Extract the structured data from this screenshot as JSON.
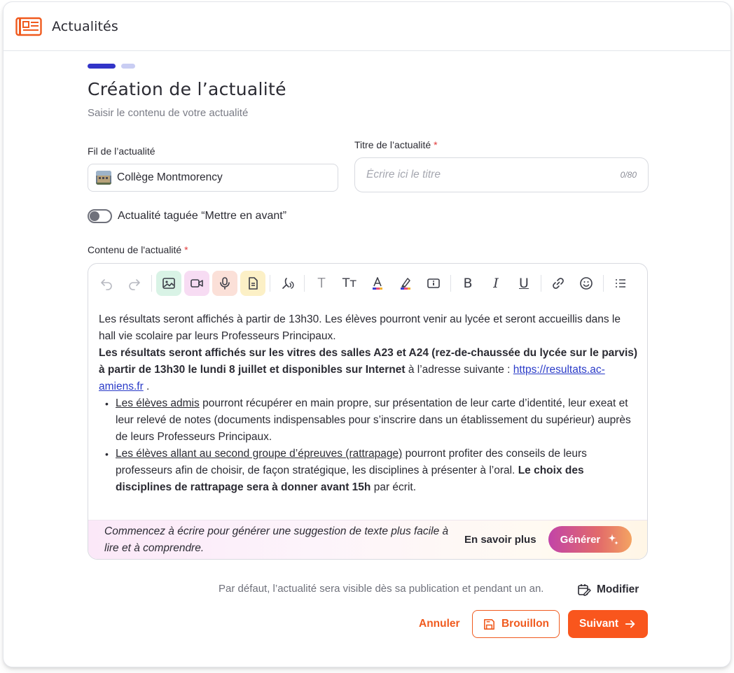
{
  "header": {
    "title": "Actualités",
    "icon": "newspaper-icon"
  },
  "steps": {
    "current": 1,
    "total": 2
  },
  "page": {
    "title": "Création de l’actualité",
    "subtitle": "Saisir le contenu de votre actualité"
  },
  "form": {
    "feed_label": "Fil de l’actualité",
    "feed_value": "Collège Montmorency",
    "title_label": "Titre de l’actualité",
    "required_mark": "*",
    "title_placeholder": "Écrire ici le titre",
    "title_counter": "0/80",
    "toggle_label": "Actualité taguée “Mettre en avant”",
    "toggle_on": false,
    "content_label": "Contenu de l'actualité"
  },
  "toolbar": {
    "tools": [
      "undo-icon",
      "redo-icon",
      "image-icon",
      "video-icon",
      "microphone-icon",
      "document-icon",
      "voice-icon",
      "text-icon",
      "text-size-icon",
      "text-color-icon",
      "highlight-icon",
      "info-box-icon",
      "bold-icon",
      "italic-icon",
      "underline-icon",
      "link-icon",
      "emoji-icon",
      "list-icon"
    ],
    "text_letter": "T",
    "text_size_letter": "Tт",
    "bold_letter": "B",
    "italic_letter": "I",
    "underline_letter": "U"
  },
  "content": {
    "p1": "Les résultats seront affichés à partir de 13h30. Les élèves pourront venir au lycée et seront accueillis dans le hall vie scolaire par leurs Professeurs Principaux.",
    "p2_bold": "Les résultats seront affichés sur les vitres des salles A23 et A24 (rez-de-chaussée du lycée sur le parvis) à partir de 13h30 le lundi 8 juillet et disponibles sur Internet",
    "p2_rest": " à l’adresse suivante : ",
    "p2_link": "https://resultats.ac-amiens.fr",
    "p2_end": " .",
    "li1_underline": "Les élèves admis",
    "li1_rest": " pourront récupérer en main propre, sur présentation de leur carte d’identité, leur exeat et leur relevé de notes (documents indispensables pour s’inscrire dans un établissement du supérieur) auprès de leurs Professeurs Principaux.",
    "li2_underline": "Les élèves allant au second groupe d’épreuves (rattrapage)",
    "li2_rest": " pourront profiter des conseils de leurs professeurs afin de choisir, de façon stratégique, les disciplines à présenter à l’oral. ",
    "li2_bold": "Le choix des disciplines de rattrapage sera à donner avant 15h",
    "li2_end": " par écrit."
  },
  "ai": {
    "hint": "Commencez à écrire pour générer une suggestion de texte plus facile à lire et à comprendre.",
    "learn_more": "En savoir plus",
    "generate": "Générer"
  },
  "footer": {
    "visibility_text": "Par défaut, l’actualité sera visible dès sa publication et pendant un an.",
    "modify": "Modifier",
    "cancel": "Annuler",
    "draft": "Brouillon",
    "next": "Suivant"
  },
  "colors": {
    "accent": "#f9561d",
    "step_active": "#3234c8",
    "step_inactive": "#c9cdf3",
    "link": "#2a3bc8"
  }
}
